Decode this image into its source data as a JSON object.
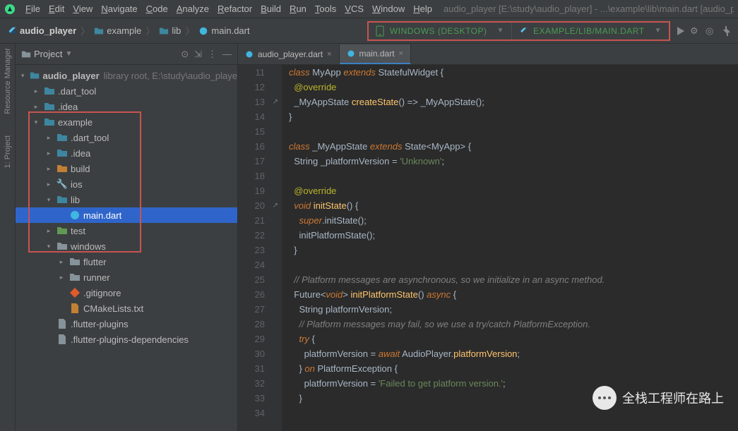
{
  "menubar": {
    "items": [
      "File",
      "Edit",
      "View",
      "Navigate",
      "Code",
      "Analyze",
      "Refactor",
      "Build",
      "Run",
      "Tools",
      "VCS",
      "Window",
      "Help"
    ],
    "title": "audio_player [E:\\study\\audio_player] - ...\\example\\lib\\main.dart [audio_pla"
  },
  "breadcrumb": {
    "root": "audio_player",
    "parts": [
      "example",
      "lib",
      "main.dart"
    ]
  },
  "selectors": {
    "device": "WINDOWS (DESKTOP)",
    "config": "EXAMPLE/LIB/MAIN.DART"
  },
  "projectPanel": {
    "title": "Project"
  },
  "rail": {
    "project": "1: Project",
    "resource": "Resource Manager"
  },
  "tree": {
    "root": {
      "name": "audio_player",
      "meta": "library root, E:\\study\\audio_playe"
    },
    "items": [
      {
        "d": 1,
        "exp": false,
        "icon": "folder-teal",
        "name": ".dart_tool"
      },
      {
        "d": 1,
        "exp": false,
        "icon": "folder-teal",
        "name": ".idea"
      },
      {
        "d": 1,
        "exp": true,
        "icon": "folder-teal",
        "name": "example",
        "boxstart": true
      },
      {
        "d": 2,
        "exp": false,
        "icon": "folder-teal",
        "name": ".dart_tool"
      },
      {
        "d": 2,
        "exp": false,
        "icon": "folder-teal",
        "name": ".idea"
      },
      {
        "d": 2,
        "exp": false,
        "icon": "folder-orange",
        "name": "build"
      },
      {
        "d": 2,
        "exp": false,
        "icon": "wrench",
        "name": "ios"
      },
      {
        "d": 2,
        "exp": true,
        "icon": "folder-teal",
        "name": "lib"
      },
      {
        "d": 3,
        "exp": null,
        "icon": "dart",
        "name": "main.dart",
        "selected": true,
        "boxend": true
      },
      {
        "d": 2,
        "exp": false,
        "icon": "folder-green",
        "name": "test"
      },
      {
        "d": 2,
        "exp": true,
        "icon": "folder-gray",
        "name": "windows"
      },
      {
        "d": 3,
        "exp": false,
        "icon": "folder-gray",
        "name": "flutter"
      },
      {
        "d": 3,
        "exp": false,
        "icon": "folder-gray",
        "name": "runner"
      },
      {
        "d": 3,
        "exp": null,
        "icon": "git",
        "name": ".gitignore"
      },
      {
        "d": 3,
        "exp": null,
        "icon": "file",
        "name": "CMakeLists.txt"
      },
      {
        "d": 2,
        "exp": null,
        "icon": "file-g",
        "name": ".flutter-plugins"
      },
      {
        "d": 2,
        "exp": null,
        "icon": "file-g",
        "name": ".flutter-plugins-dependencies"
      }
    ]
  },
  "tabs": [
    {
      "name": "audio_player.dart",
      "active": false
    },
    {
      "name": "main.dart",
      "active": true
    }
  ],
  "code": {
    "start": 11,
    "lines": [
      {
        "n": 11,
        "html": "<span class='kw'>class</span> <span class='cls'>MyApp</span> <span class='kw'>extends</span> <span class='cls'>StatefulWidget</span> {"
      },
      {
        "n": 12,
        "html": "  <span class='ann'>@override</span>"
      },
      {
        "n": 13,
        "html": "  <span class='cls'>_MyAppState</span> <span class='fn'>createState</span>() =&gt; <span class='cls'>_MyAppState</span>();",
        "mark": "↗"
      },
      {
        "n": 14,
        "html": "}"
      },
      {
        "n": 15,
        "html": ""
      },
      {
        "n": 16,
        "html": "<span class='kw'>class</span> <span class='cls'>_MyAppState</span> <span class='kw'>extends</span> <span class='cls'>State</span>&lt;<span class='type'>MyApp</span>&gt; {"
      },
      {
        "n": 17,
        "html": "  <span class='type'>String</span> _platformVersion = <span class='str'>'Unknown'</span>;"
      },
      {
        "n": 18,
        "html": ""
      },
      {
        "n": 19,
        "html": "  <span class='ann'>@override</span>"
      },
      {
        "n": 20,
        "html": "  <span class='kw'>void</span> <span class='fn'>initState</span>() {",
        "mark": "↗"
      },
      {
        "n": 21,
        "html": "    <span class='kw'>super</span>.initState();"
      },
      {
        "n": 22,
        "html": "    initPlatformState();"
      },
      {
        "n": 23,
        "html": "  }"
      },
      {
        "n": 24,
        "html": ""
      },
      {
        "n": 25,
        "html": "  <span class='cm'>// Platform messages are asynchronous, so we initialize in an async method.</span>"
      },
      {
        "n": 26,
        "html": "  <span class='type'>Future</span>&lt;<span class='kw'>void</span>&gt; <span class='fn'>initPlatformState</span>() <span class='kw'>async</span> {"
      },
      {
        "n": 27,
        "html": "    <span class='type'>String</span> platformVersion;"
      },
      {
        "n": 28,
        "html": "    <span class='cm'>// Platform messages may fail, so we use a try/catch PlatformException.</span>"
      },
      {
        "n": 29,
        "html": "    <span class='kw'>try</span> {"
      },
      {
        "n": 30,
        "html": "      platformVersion = <span class='kw'>await</span> <span class='cls'>AudioPlayer</span>.<span class='fn'>platformVersion</span>;"
      },
      {
        "n": 31,
        "html": "    } <span class='kw'>on</span> <span class='cls'>PlatformException</span> {"
      },
      {
        "n": 32,
        "html": "      platformVersion = <span class='str'>'Failed to get platform version.'</span>;"
      },
      {
        "n": 33,
        "html": "    }"
      },
      {
        "n": 34,
        "html": ""
      }
    ]
  },
  "watermark": "全栈工程师在路上"
}
